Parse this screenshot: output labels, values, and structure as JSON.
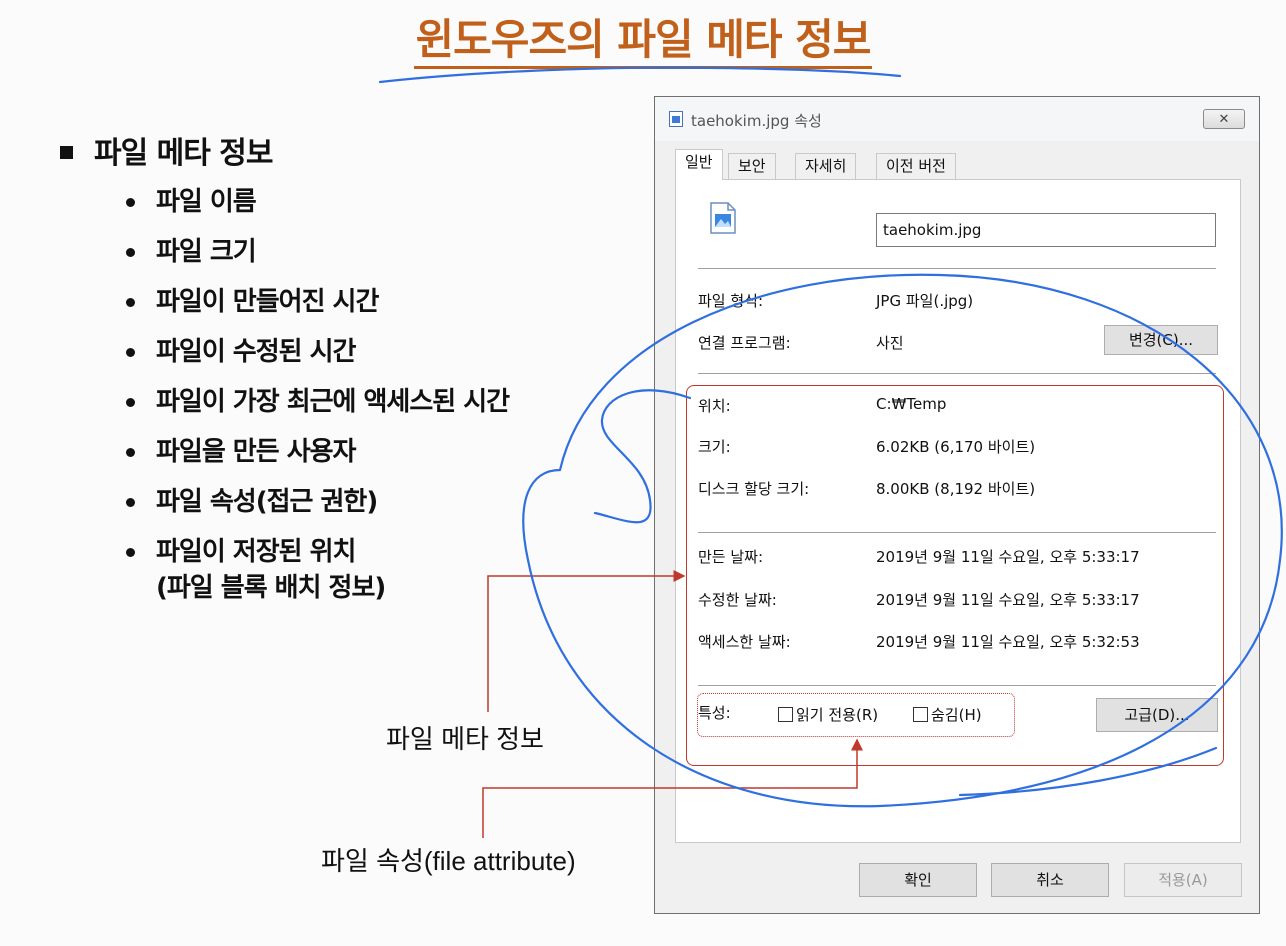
{
  "title": "윈도우즈의 파일 메타 정보",
  "main_bullet": "파일 메타 정보",
  "sub_bullets": [
    "파일 이름",
    "파일 크기",
    "파일이 만들어진 시간",
    "파일이 수정된 시간",
    "파일이 가장 최근에 액세스된 시간",
    "파일을 만든 사용자",
    "파일 속성(접근 권한)",
    "파일이 저장된 위치\n(파일 블록   배치 정보)"
  ],
  "callouts": {
    "meta_label": "파일  메타  정보",
    "attr_label": "파일  속성(file attribute)"
  },
  "dialog": {
    "title": "taehokim.jpg 속성",
    "close_glyph": "✕",
    "tabs": [
      "일반",
      "보안",
      "자세히",
      "이전 버전"
    ],
    "filename": "taehokim.jpg",
    "file_type": {
      "label": "파일 형식:",
      "value": "JPG 파일(.jpg)"
    },
    "open_with": {
      "label": "연결 프로그램:",
      "value": "사진",
      "button": "변경(C)..."
    },
    "location": {
      "label": "위치:",
      "value": "C:₩Temp"
    },
    "size": {
      "label": "크기:",
      "value": "6.02KB (6,170 바이트)"
    },
    "disk_size": {
      "label": "디스크 할당 크기:",
      "value": "8.00KB (8,192 바이트)"
    },
    "created": {
      "label": "만든 날짜:",
      "value": "2019년 9월 11일 수요일, 오후 5:33:17"
    },
    "modified": {
      "label": "수정한 날짜:",
      "value": "2019년 9월 11일 수요일, 오후 5:33:17"
    },
    "accessed": {
      "label": "액세스한 날짜:",
      "value": "2019년 9월 11일 수요일, 오후 5:32:53"
    },
    "attributes": {
      "label": "특성:",
      "readonly": "읽기 전용(R)",
      "hidden": "숨김(H)",
      "advanced_button": "고급(D)..."
    },
    "buttons": {
      "ok": "확인",
      "cancel": "취소",
      "apply": "적용(A)"
    }
  },
  "colors": {
    "title": "#c0601a",
    "callout_red": "#c0392b",
    "pen_blue": "#2f6fe0"
  }
}
